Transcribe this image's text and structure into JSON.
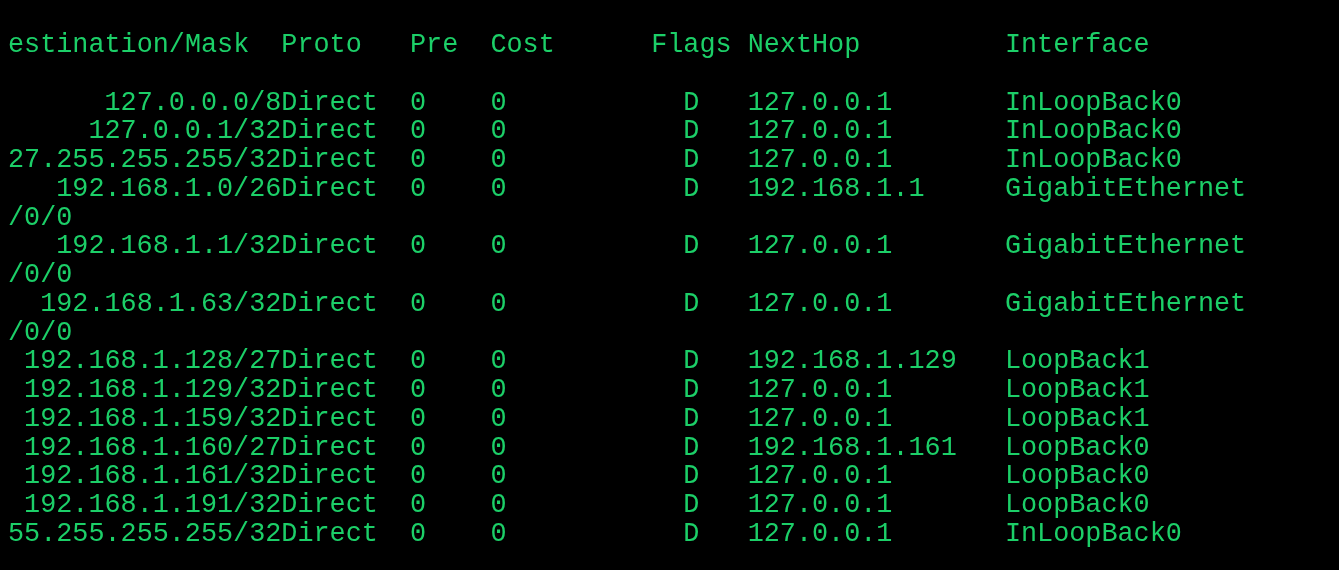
{
  "columns": [
    {
      "label": "estination/Mask"
    },
    {
      "label": "Proto"
    },
    {
      "label": "Pre"
    },
    {
      "label": "Cost"
    },
    {
      "label": "Flags"
    },
    {
      "label": "NextHop"
    },
    {
      "label": "Interface"
    }
  ],
  "rows": [
    {
      "destination": "127.0.0.0/8",
      "proto": "Direct",
      "pre": "0",
      "cost": "0",
      "flags": "D",
      "next_hop": "127.0.0.1",
      "interface": "InLoopBack0"
    },
    {
      "destination": "127.0.0.1/32",
      "proto": "Direct",
      "pre": "0",
      "cost": "0",
      "flags": "D",
      "next_hop": "127.0.0.1",
      "interface": "InLoopBack0"
    },
    {
      "destination": "27.255.255.255/32",
      "proto": "Direct",
      "pre": "0",
      "cost": "0",
      "flags": "D",
      "next_hop": "127.0.0.1",
      "interface": "InLoopBack0"
    },
    {
      "destination": "192.168.1.0/26",
      "proto": "Direct",
      "pre": "0",
      "cost": "0",
      "flags": "D",
      "next_hop": "192.168.1.1",
      "interface": "GigabitEthernet",
      "wrap": "/0/0"
    },
    {
      "destination": "192.168.1.1/32",
      "proto": "Direct",
      "pre": "0",
      "cost": "0",
      "flags": "D",
      "next_hop": "127.0.0.1",
      "interface": "GigabitEthernet",
      "wrap": "/0/0"
    },
    {
      "destination": "192.168.1.63/32",
      "proto": "Direct",
      "pre": "0",
      "cost": "0",
      "flags": "D",
      "next_hop": "127.0.0.1",
      "interface": "GigabitEthernet",
      "wrap": "/0/0"
    },
    {
      "destination": "192.168.1.128/27",
      "proto": "Direct",
      "pre": "0",
      "cost": "0",
      "flags": "D",
      "next_hop": "192.168.1.129",
      "interface": "LoopBack1"
    },
    {
      "destination": "192.168.1.129/32",
      "proto": "Direct",
      "pre": "0",
      "cost": "0",
      "flags": "D",
      "next_hop": "127.0.0.1",
      "interface": "LoopBack1"
    },
    {
      "destination": "192.168.1.159/32",
      "proto": "Direct",
      "pre": "0",
      "cost": "0",
      "flags": "D",
      "next_hop": "127.0.0.1",
      "interface": "LoopBack1"
    },
    {
      "destination": "192.168.1.160/27",
      "proto": "Direct",
      "pre": "0",
      "cost": "0",
      "flags": "D",
      "next_hop": "192.168.1.161",
      "interface": "LoopBack0"
    },
    {
      "destination": "192.168.1.161/32",
      "proto": "Direct",
      "pre": "0",
      "cost": "0",
      "flags": "D",
      "next_hop": "127.0.0.1",
      "interface": "LoopBack0"
    },
    {
      "destination": "192.168.1.191/32",
      "proto": "Direct",
      "pre": "0",
      "cost": "0",
      "flags": "D",
      "next_hop": "127.0.0.1",
      "interface": "LoopBack0"
    },
    {
      "destination": "55.255.255.255/32",
      "proto": "Direct",
      "pre": "0",
      "cost": "0",
      "flags": "D",
      "next_hop": "127.0.0.1",
      "interface": "InLoopBack0"
    }
  ]
}
